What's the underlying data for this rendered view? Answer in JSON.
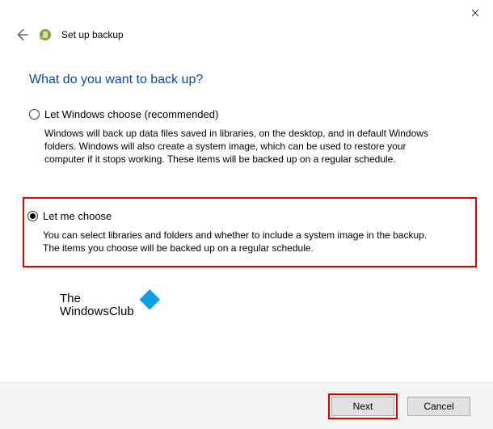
{
  "window": {
    "title": "Set up backup"
  },
  "heading": "What do you want to back up?",
  "options": {
    "auto": {
      "label": "Let Windows choose (recommended)",
      "desc": "Windows will back up data files saved in libraries, on the desktop, and in default Windows folders. Windows will also create a system image, which can be used to restore your computer if it stops working. These items will be backed up on a regular schedule.",
      "selected": false
    },
    "manual": {
      "label": "Let me choose",
      "desc": "You can select libraries and folders and whether to include a system image in the backup. The items you choose will be backed up on a regular schedule.",
      "selected": true
    }
  },
  "watermark": {
    "line1": "The",
    "line2": "WindowsClub"
  },
  "buttons": {
    "next": "Next",
    "cancel": "Cancel"
  }
}
